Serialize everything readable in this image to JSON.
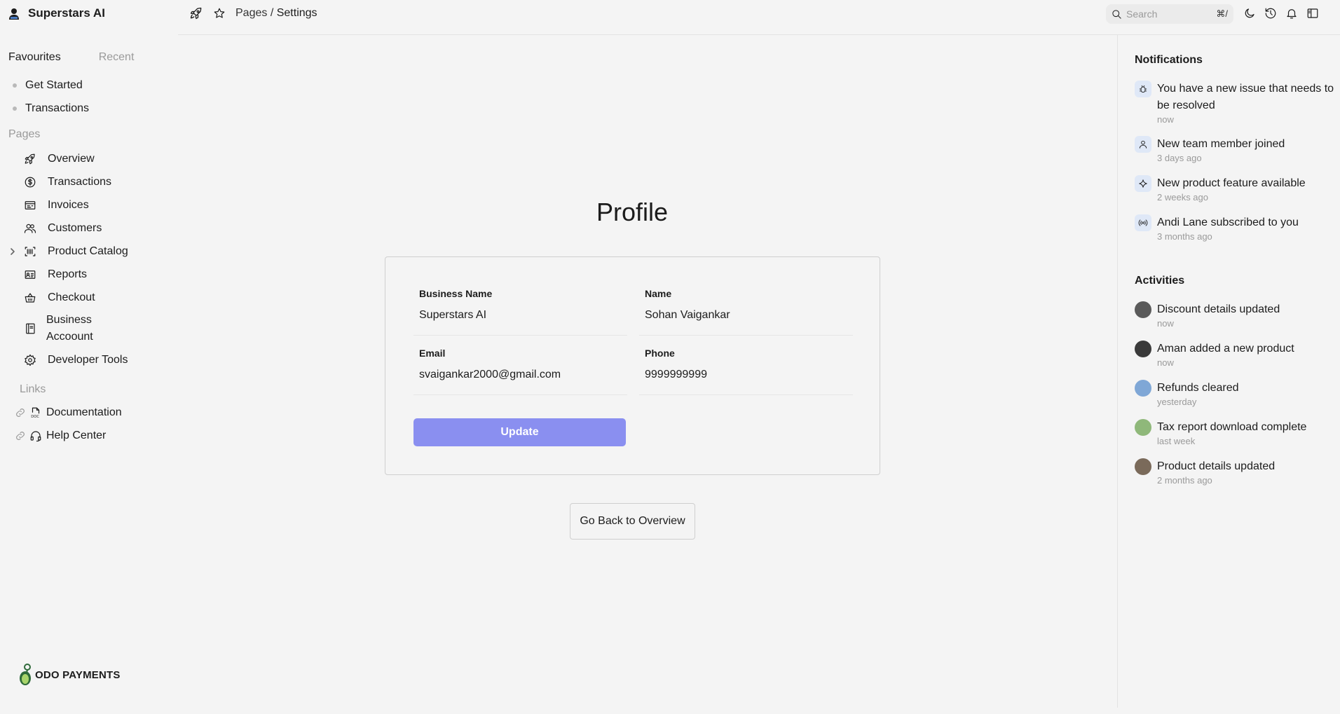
{
  "app": {
    "name": "Superstars AI"
  },
  "sidebar": {
    "tabs": {
      "favourites": "Favourites",
      "recent": "Recent"
    },
    "favourites": [
      "Get Started",
      "Transactions"
    ],
    "pages_label": "Pages",
    "pages": [
      {
        "label": "Overview",
        "icon": "rocket-icon"
      },
      {
        "label": "Transactions",
        "icon": "dollar-circle-icon"
      },
      {
        "label": "Invoices",
        "icon": "invoice-icon"
      },
      {
        "label": "Customers",
        "icon": "users-icon"
      },
      {
        "label": "Product Catalog",
        "icon": "barcode-icon"
      },
      {
        "label": "Reports",
        "icon": "report-icon"
      },
      {
        "label": "Checkout",
        "icon": "basket-icon"
      },
      {
        "label": "Business Accoount",
        "icon": "notebook-icon"
      },
      {
        "label": "Developer Tools",
        "icon": "gear-icon"
      }
    ],
    "links_label": "Links",
    "links": [
      {
        "label": "Documentation",
        "icon": "doc-icon"
      },
      {
        "label": "Help Center",
        "icon": "headset-icon"
      }
    ],
    "footer_logo": "ODO PAYMENTS"
  },
  "topbar": {
    "breadcrumb_parent": "Pages",
    "breadcrumb_sep": "/",
    "breadcrumb_current": "Settings",
    "search_placeholder": "Search",
    "search_shortcut": "⌘/"
  },
  "main": {
    "title": "Profile",
    "fields": {
      "business_name_label": "Business Name",
      "business_name": "Superstars AI",
      "name_label": "Name",
      "name": "Sohan Vaigankar",
      "email_label": "Email",
      "email": "svaigankar2000@gmail.com",
      "phone_label": "Phone",
      "phone": "9999999999"
    },
    "update_label": "Update",
    "back_label": "Go Back to Overview",
    "accent_color": "#8a8ff0"
  },
  "notifications": {
    "title": "Notifications",
    "items": [
      {
        "text": "You have a new issue that needs to be resolved",
        "time": "now",
        "icon": "bug-icon"
      },
      {
        "text": "New team member joined",
        "time": "3 days ago",
        "icon": "user-icon"
      },
      {
        "text": "New product feature available",
        "time": "2 weeks ago",
        "icon": "sparkle-icon"
      },
      {
        "text": "Andi Lane subscribed to you",
        "time": "3 months ago",
        "icon": "broadcast-icon"
      }
    ]
  },
  "activities": {
    "title": "Activities",
    "items": [
      {
        "text": "Discount details updated",
        "time": "now",
        "color": "#5a5a5a"
      },
      {
        "text": "Aman added a new product",
        "time": "now",
        "color": "#3a3a3a"
      },
      {
        "text": "Refunds cleared",
        "time": "yesterday",
        "color": "#7fa7d6"
      },
      {
        "text": "Tax report download complete",
        "time": "last week",
        "color": "#8fb87a"
      },
      {
        "text": "Product details updated",
        "time": "2 months ago",
        "color": "#7a6a5a"
      }
    ]
  }
}
